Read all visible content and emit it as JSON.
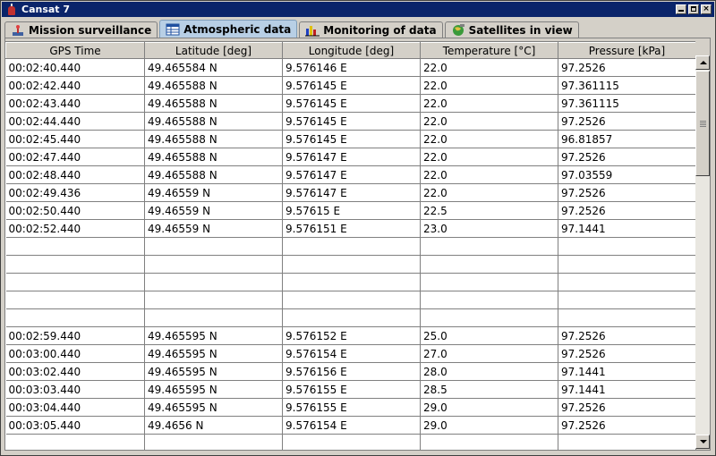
{
  "window": {
    "title": "Cansat 7"
  },
  "tabs": [
    {
      "label": "Mission surveillance",
      "icon": "antenna-icon",
      "active": false
    },
    {
      "label": "Atmospheric data",
      "icon": "table-icon",
      "active": true
    },
    {
      "label": "Monitoring of data",
      "icon": "bar-chart-icon",
      "active": false
    },
    {
      "label": "Satellites in view",
      "icon": "globe-icon",
      "active": false
    }
  ],
  "table": {
    "columns": [
      "GPS Time",
      "Latitude [deg]",
      "Longitude [deg]",
      "Temperature [°C]",
      "Pressure [kPa]"
    ],
    "rows": [
      [
        "00:02:40.440",
        "49.465584 N",
        "9.576146 E",
        "22.0",
        "97.2526"
      ],
      [
        "00:02:42.440",
        "49.465588 N",
        "9.576145 E",
        "22.0",
        "97.361115"
      ],
      [
        "00:02:43.440",
        "49.465588 N",
        "9.576145 E",
        "22.0",
        "97.361115"
      ],
      [
        "00:02:44.440",
        "49.465588 N",
        "9.576145 E",
        "22.0",
        "97.2526"
      ],
      [
        "00:02:45.440",
        "49.465588 N",
        "9.576145 E",
        "22.0",
        "96.81857"
      ],
      [
        "00:02:47.440",
        "49.465588 N",
        "9.576147 E",
        "22.0",
        "97.2526"
      ],
      [
        "00:02:48.440",
        "49.465588 N",
        "9.576147 E",
        "22.0",
        "97.03559"
      ],
      [
        "00:02:49.436",
        "49.46559 N",
        "9.576147 E",
        "22.0",
        "97.2526"
      ],
      [
        "00:02:50.440",
        "49.46559 N",
        "9.57615 E",
        "22.5",
        "97.2526"
      ],
      [
        "00:02:52.440",
        "49.46559 N",
        "9.576151 E",
        "23.0",
        "97.1441"
      ],
      [
        "",
        "",
        "",
        "",
        ""
      ],
      [
        "",
        "",
        "",
        "",
        ""
      ],
      [
        "",
        "",
        "",
        "",
        ""
      ],
      [
        "",
        "",
        "",
        "",
        ""
      ],
      [
        "",
        "",
        "",
        "",
        ""
      ],
      [
        "00:02:59.440",
        "49.465595 N",
        "9.576152 E",
        "25.0",
        "97.2526"
      ],
      [
        "00:03:00.440",
        "49.465595 N",
        "9.576154 E",
        "27.0",
        "97.2526"
      ],
      [
        "00:03:02.440",
        "49.465595 N",
        "9.576156 E",
        "28.0",
        "97.1441"
      ],
      [
        "00:03:03.440",
        "49.465595 N",
        "9.576155 E",
        "28.5",
        "97.1441"
      ],
      [
        "00:03:04.440",
        "49.465595 N",
        "9.576155 E",
        "29.0",
        "97.2526"
      ],
      [
        "00:03:05.440",
        "49.4656 N",
        "9.576154 E",
        "29.0",
        "97.2526"
      ],
      [
        "",
        "",
        "",
        "",
        ""
      ]
    ]
  },
  "colors": {
    "titlebar": "#0a246a",
    "active_tab": "#b8cfe5",
    "chrome": "#d4d0c8"
  }
}
